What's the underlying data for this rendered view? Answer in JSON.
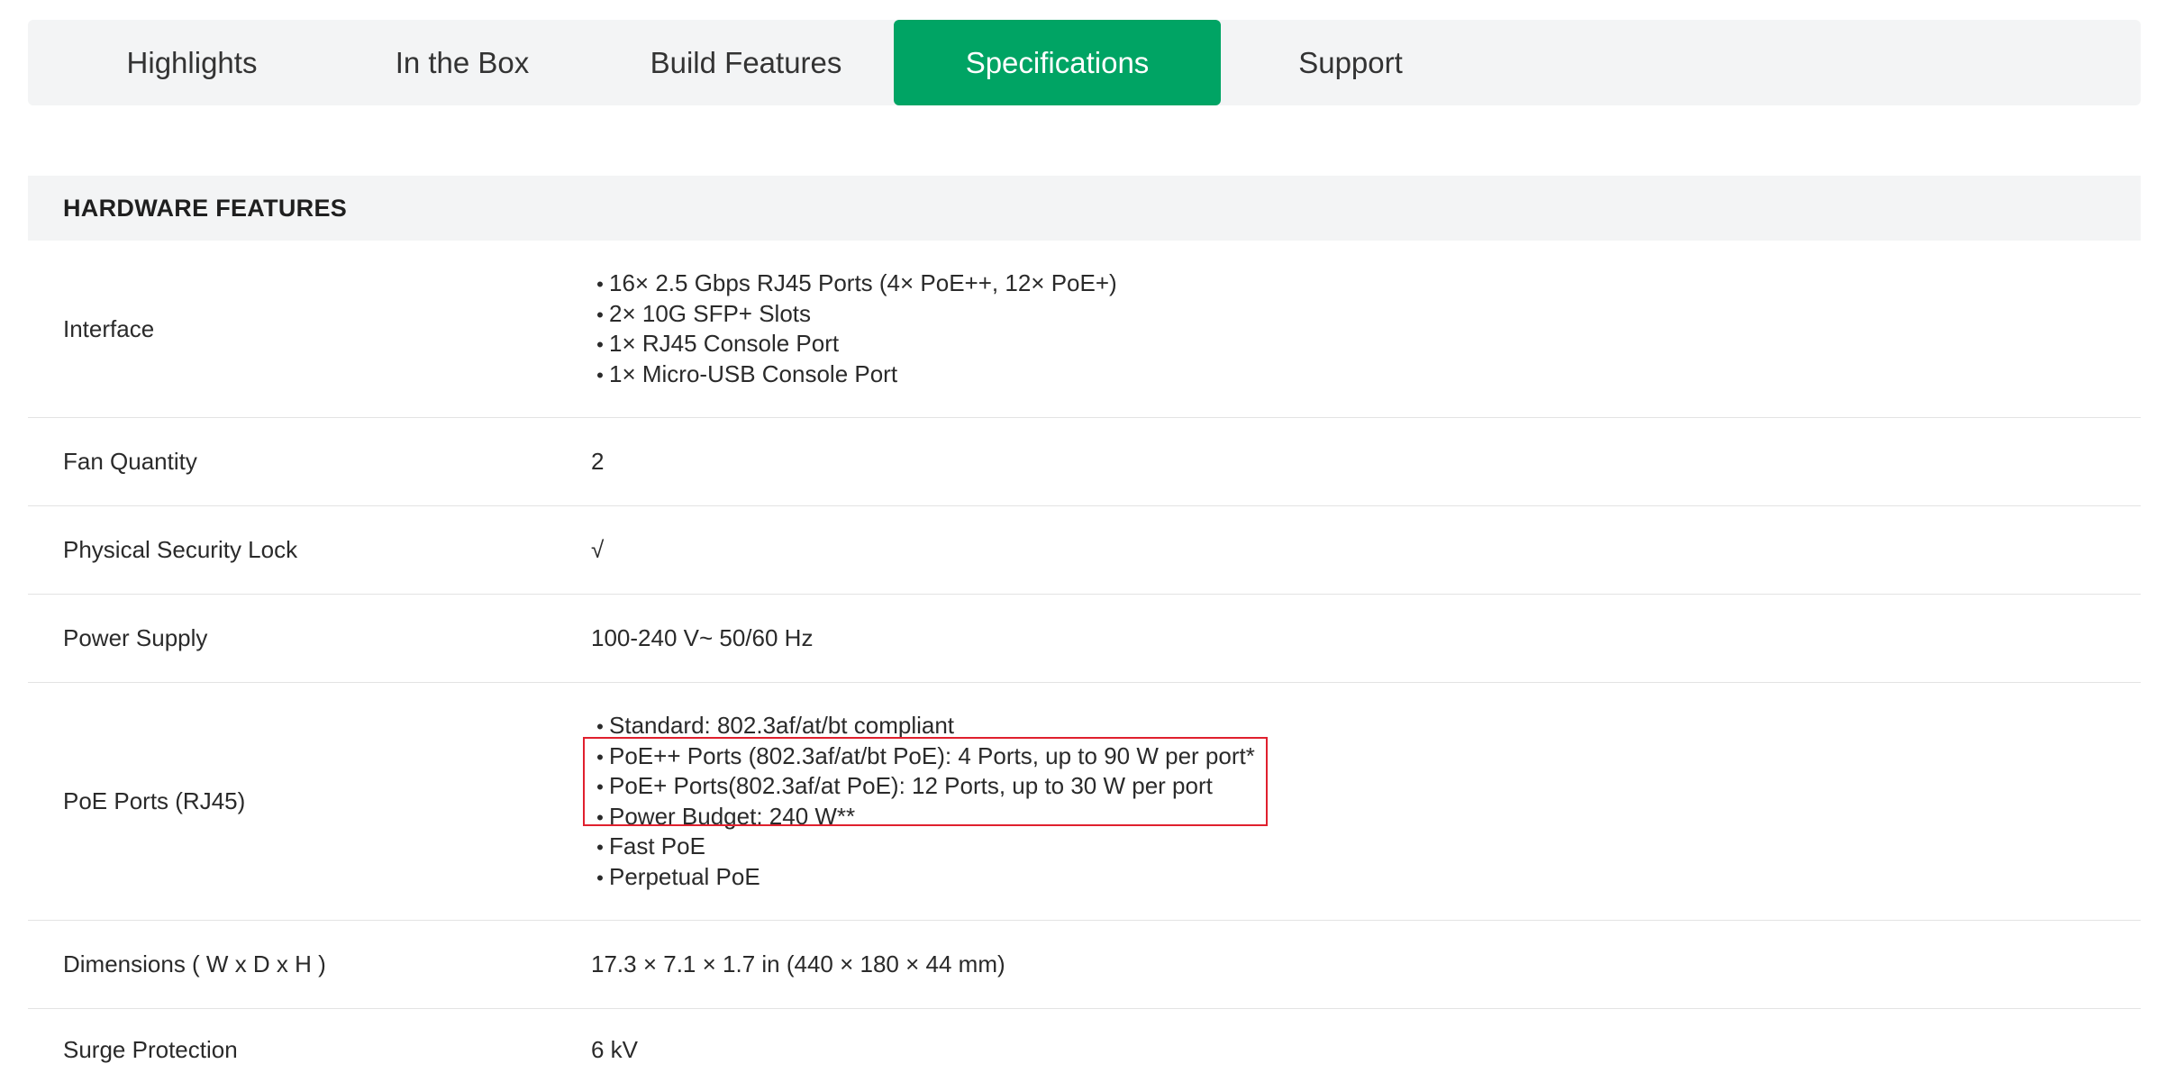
{
  "tabs": [
    {
      "label": "Highlights",
      "active": false
    },
    {
      "label": "In the Box",
      "active": false
    },
    {
      "label": "Build Features",
      "active": false
    },
    {
      "label": "Specifications",
      "active": true
    },
    {
      "label": "Support",
      "active": false
    }
  ],
  "accent_color": "#00a464",
  "highlight_color": "#e0202e",
  "section": {
    "title": "HARDWARE FEATURES"
  },
  "specs": {
    "interface": {
      "label": "Interface",
      "items": [
        "16× 2.5 Gbps RJ45 Ports (4× PoE++, 12× PoE+)",
        "2× 10G SFP+ Slots",
        "1× RJ45 Console Port",
        "1× Micro-USB Console Port"
      ]
    },
    "fan_quantity": {
      "label": "Fan Quantity",
      "value": "2"
    },
    "security_lock": {
      "label": "Physical Security Lock",
      "value": "√"
    },
    "power_supply": {
      "label": "Power Supply",
      "value": "100-240 V~ 50/60 Hz"
    },
    "poe_ports": {
      "label": "PoE Ports (RJ45)",
      "items": [
        "Standard: 802.3af/at/bt compliant",
        "PoE++ Ports (802.3af/at/bt PoE): 4 Ports, up to 90 W per port*",
        "PoE+ Ports(802.3af/at PoE): 12 Ports, up to 30 W per port",
        "Power Budget: 240 W**",
        "Fast PoE",
        "Perpetual PoE"
      ]
    },
    "dimensions": {
      "label": "Dimensions ( W x D x H )",
      "value": "17.3 × 7.1 × 1.7 in (440 × 180 × 44 mm)"
    },
    "surge_protection": {
      "label": "Surge Protection",
      "value": "6 kV"
    }
  }
}
